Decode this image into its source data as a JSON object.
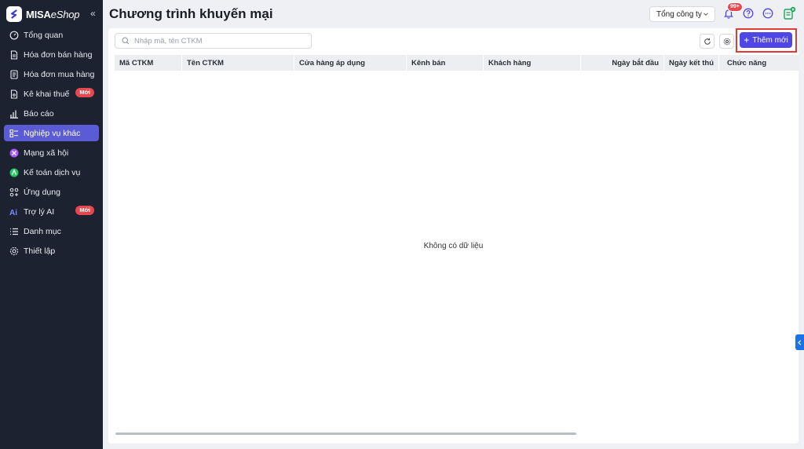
{
  "app": {
    "brand_bold": "MISA",
    "brand_light": "eShop",
    "collapse_glyph": "«"
  },
  "sidebar": {
    "items": [
      {
        "label": "Tổng quan",
        "icon": "dashboard-icon"
      },
      {
        "label": "Hóa đơn bán hàng",
        "icon": "invoice-icon"
      },
      {
        "label": "Hóa đơn mua hàng",
        "icon": "purchase-invoice-icon"
      },
      {
        "label": "Kê khai thuế",
        "icon": "tax-icon",
        "badge": "Mới"
      },
      {
        "label": "Báo cáo",
        "icon": "report-icon"
      },
      {
        "label": "Nghiệp vụ khác",
        "icon": "tasks-icon",
        "active": true
      },
      {
        "label": "Mạng xã hội",
        "icon": "social-icon"
      },
      {
        "label": "Kế toán dịch vụ",
        "icon": "accounting-icon"
      },
      {
        "label": "Ứng dụng",
        "icon": "apps-icon"
      },
      {
        "label": "Trợ lý AI",
        "icon": "ai-icon",
        "badge": "Mới"
      },
      {
        "label": "Danh mục",
        "icon": "list-icon"
      },
      {
        "label": "Thiết lập",
        "icon": "settings-icon"
      }
    ]
  },
  "header": {
    "title": "Chương trình khuyến mại",
    "company_select": "Tổng công ty",
    "notification_count": "99+"
  },
  "toolbar": {
    "search_placeholder": "Nhập mã, tên CTKM",
    "add_label": "Thêm mới",
    "add_glyph": "+"
  },
  "table": {
    "columns": [
      "Mã CTKM",
      "Tên CTKM",
      "Cửa hàng áp dụng",
      "Kênh bán",
      "Khách hàng",
      "Ngày bắt đầu",
      "Ngày kết thú",
      "Chức năng"
    ],
    "empty_text": "Không có dữ liệu"
  },
  "colors": {
    "sidebar_bg": "#1c2230",
    "accent": "#4f46e5",
    "active_item": "#5b5bd6",
    "badge": "#e5484d",
    "highlight": "#e53935"
  }
}
